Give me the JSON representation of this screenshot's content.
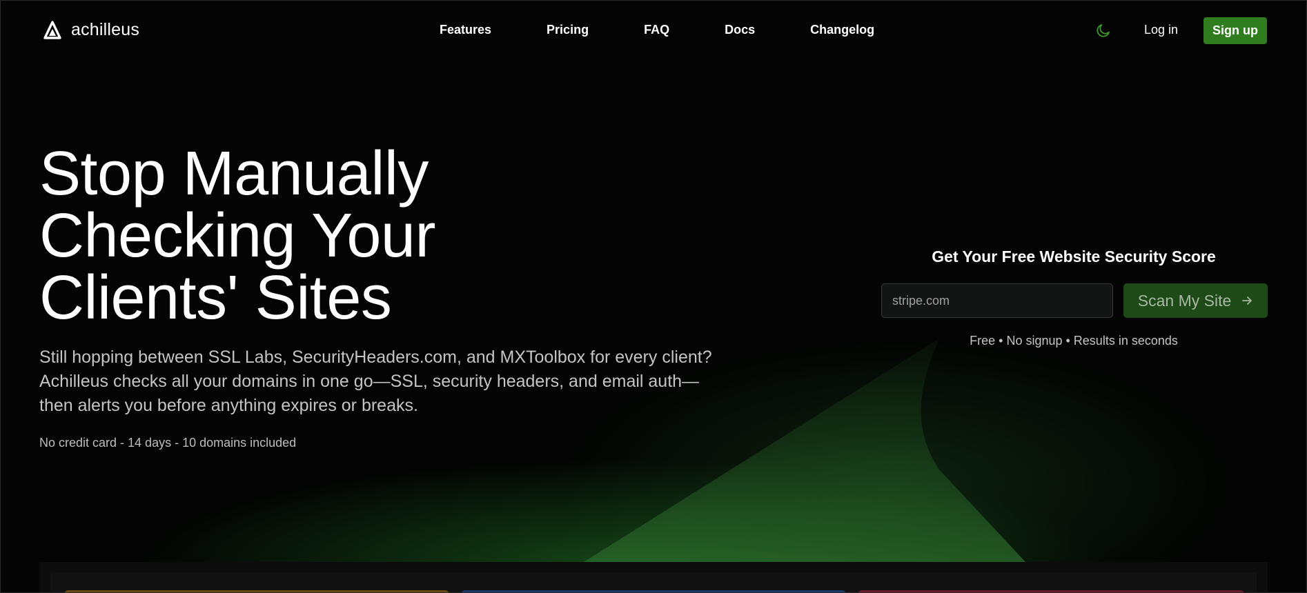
{
  "brand": {
    "name": "achilleus"
  },
  "nav": {
    "items": [
      {
        "label": "Features"
      },
      {
        "label": "Pricing"
      },
      {
        "label": "FAQ"
      },
      {
        "label": "Docs"
      },
      {
        "label": "Changelog"
      }
    ]
  },
  "header": {
    "theme_icon": "moon-icon",
    "login_label": "Log in",
    "signup_label": "Sign up"
  },
  "hero": {
    "title_lines": [
      "Stop Manually",
      "Checking Your",
      "Clients' Sites"
    ],
    "description": "Still hopping between SSL Labs, SecurityHeaders.com, and MXToolbox for every client? Achilleus checks all your domains in one go—SSL, security headers, and email auth—then alerts you before anything expires or breaks.",
    "note": "No credit card - 14 days - 10 domains included"
  },
  "scan": {
    "title": "Get Your Free Website Security Score",
    "input_placeholder": "stripe.com",
    "input_value": "",
    "button_label": "Scan My Site",
    "button_icon": "arrow-right-icon",
    "note": "Free • No signup • Results in seconds"
  },
  "colors": {
    "accent": "#2f7d1f",
    "accent_muted": "#1d4a17",
    "background": "#030403",
    "card_orange": "#6b4a12",
    "card_blue": "#1b3a6b",
    "card_red": "#6b1a2a"
  }
}
